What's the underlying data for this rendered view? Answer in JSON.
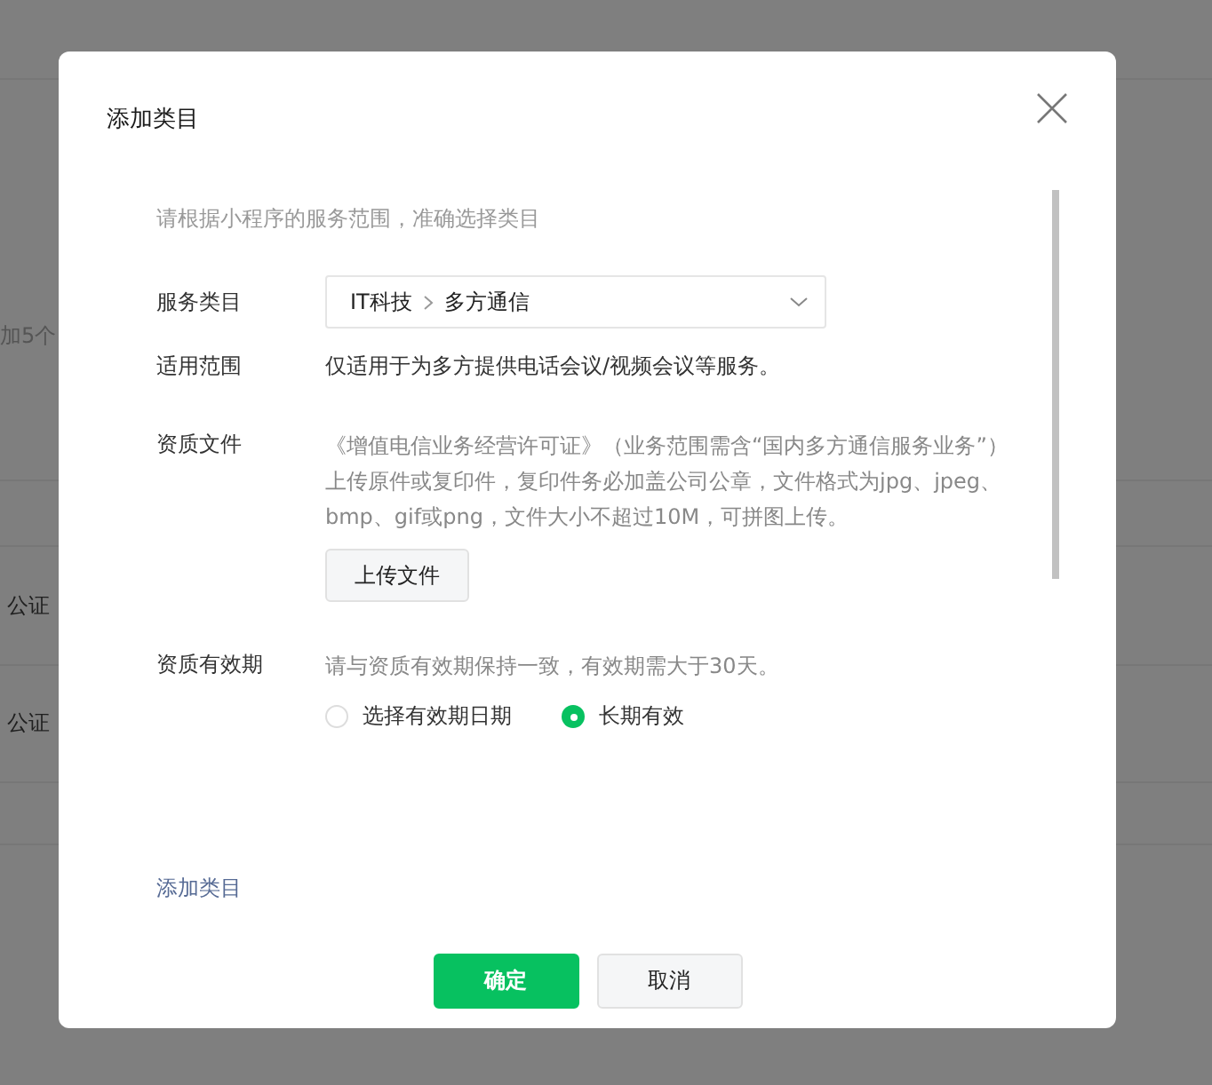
{
  "background": {
    "note": "加5个",
    "rows": [
      "公证",
      "公证"
    ]
  },
  "dialog": {
    "title": "添加类目",
    "hint": "请根据小程序的服务范围，准确选择类目",
    "category": {
      "label": "服务类目",
      "path": [
        "IT科技",
        "多方通信"
      ]
    },
    "scope": {
      "label": "适用范围",
      "text": "仅适用于为多方提供电话会议/视频会议等服务。"
    },
    "documents": {
      "label": "资质文件",
      "lines": [
        "《增值电信业务经营许可证》（业务范围需含“国内多方通信服务业务”）",
        "上传原件或复印件，复印件务必加盖公司公章，文件格式为jpg、jpeg、",
        "bmp、gif或png，文件大小不超过10M，可拼图上传。"
      ],
      "button": "上传文件"
    },
    "validity": {
      "label": "资质有效期",
      "hint": "请与资质有效期保持一致，有效期需大于30天。",
      "options": [
        {
          "label": "选择有效期日期",
          "selected": false
        },
        {
          "label": "长期有效",
          "selected": true
        }
      ]
    },
    "add_link": "添加类目",
    "buttons": [
      {
        "label": "确定",
        "kind": "primary"
      },
      {
        "label": "取消",
        "kind": "secondary"
      }
    ]
  }
}
